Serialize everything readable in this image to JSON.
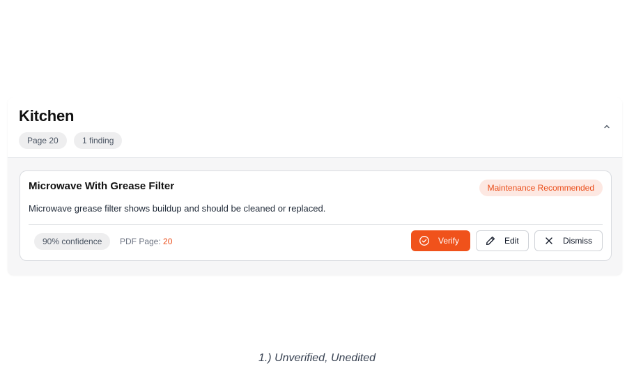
{
  "section": {
    "title": "Kitchen",
    "page_pill": "Page 20",
    "findings_pill": "1 finding",
    "collapse_icon": "chevron-up-icon"
  },
  "finding": {
    "title": "Microwave With Grease Filter",
    "status": "Maintenance Recommended",
    "description": "Microwave grease filter shows buildup and should be cleaned or replaced.",
    "confidence": "90% confidence",
    "pdf_page_label": "PDF Page:",
    "pdf_page_number": "20",
    "actions": {
      "verify": "Verify",
      "edit": "Edit",
      "dismiss": "Dismiss"
    }
  },
  "caption": "1.) Unverified, Unedited",
  "colors": {
    "accent": "#f0521b",
    "status_text": "#ea4e1b",
    "status_bg": "#fde8e2",
    "pill_bg": "#eeeeef"
  },
  "icons": {
    "verify": "check-circle-icon",
    "edit": "pencil-icon",
    "dismiss": "close-icon"
  }
}
